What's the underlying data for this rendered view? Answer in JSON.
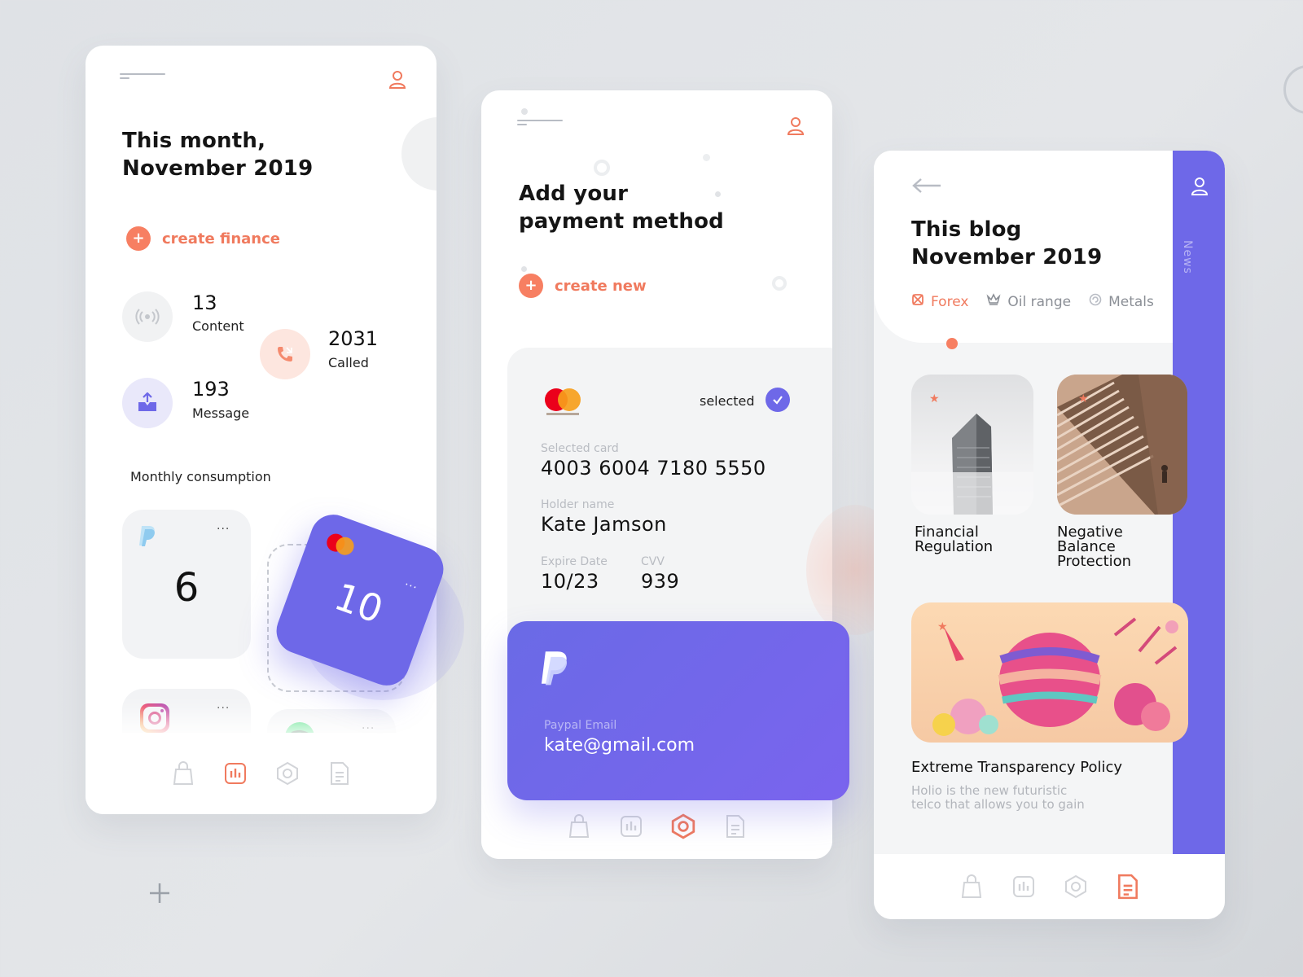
{
  "colors": {
    "accent": "#f77f62",
    "purple": "#6e68e8",
    "tile": "#f2f3f5",
    "muted": "#b9bcc2"
  },
  "screen1": {
    "title_line1": "This month,",
    "title_line2": "November 2019",
    "create_label": "create finance",
    "stats": [
      {
        "value": "13",
        "label": "Content",
        "icon": "broadcast-icon"
      },
      {
        "value": "2031",
        "label": "Called",
        "icon": "phone-icon"
      },
      {
        "value": "193",
        "label": "Message",
        "icon": "mail-icon"
      }
    ],
    "section_title": "Monthly consumption",
    "tiles": [
      {
        "brand": "paypal",
        "value": "6",
        "more": "..."
      },
      {
        "brand": "mastercard",
        "value": "10",
        "more": "..."
      },
      {
        "brand": "instagram",
        "more": "..."
      },
      {
        "brand": "spotify",
        "more": "..."
      }
    ]
  },
  "screen2": {
    "title_line1": "Add your",
    "title_line2": "payment method",
    "create_label": "create new",
    "card": {
      "status": "selected",
      "selected_card_label": "Selected card",
      "card_number": "4003 6004 7180 5550",
      "holder_label": "Holder name",
      "holder_name": "Kate Jamson",
      "expire_label": "Expire Date",
      "expire_value": "10/23",
      "cvv_label": "CVV",
      "cvv_value": "939"
    },
    "paypal": {
      "email_label": "Paypal Email",
      "email_value": "kate@gmail.com"
    }
  },
  "screen3": {
    "title_line1": "This blog",
    "title_line2": "November 2019",
    "side_label": "News",
    "tabs": [
      {
        "label": "Forex",
        "active": true,
        "icon": "forex-icon"
      },
      {
        "label": "Oil range",
        "active": false,
        "icon": "crown-icon"
      },
      {
        "label": "Metals",
        "active": false,
        "icon": "spiral-icon"
      }
    ],
    "posts": [
      {
        "line1": "Financial",
        "line2": "Regulation",
        "line3": ""
      },
      {
        "line1": "Negative",
        "line2": "Balance",
        "line3": "Protection"
      }
    ],
    "featured": {
      "title": "Extreme Transparency Policy",
      "desc_line1": "Holio is the new futuristic",
      "desc_line2": "telco that allows you to gain"
    }
  },
  "nav": {
    "items": [
      "bag-icon",
      "chart-icon",
      "hexagon-icon",
      "document-icon"
    ],
    "active": [
      1,
      2,
      3
    ]
  }
}
